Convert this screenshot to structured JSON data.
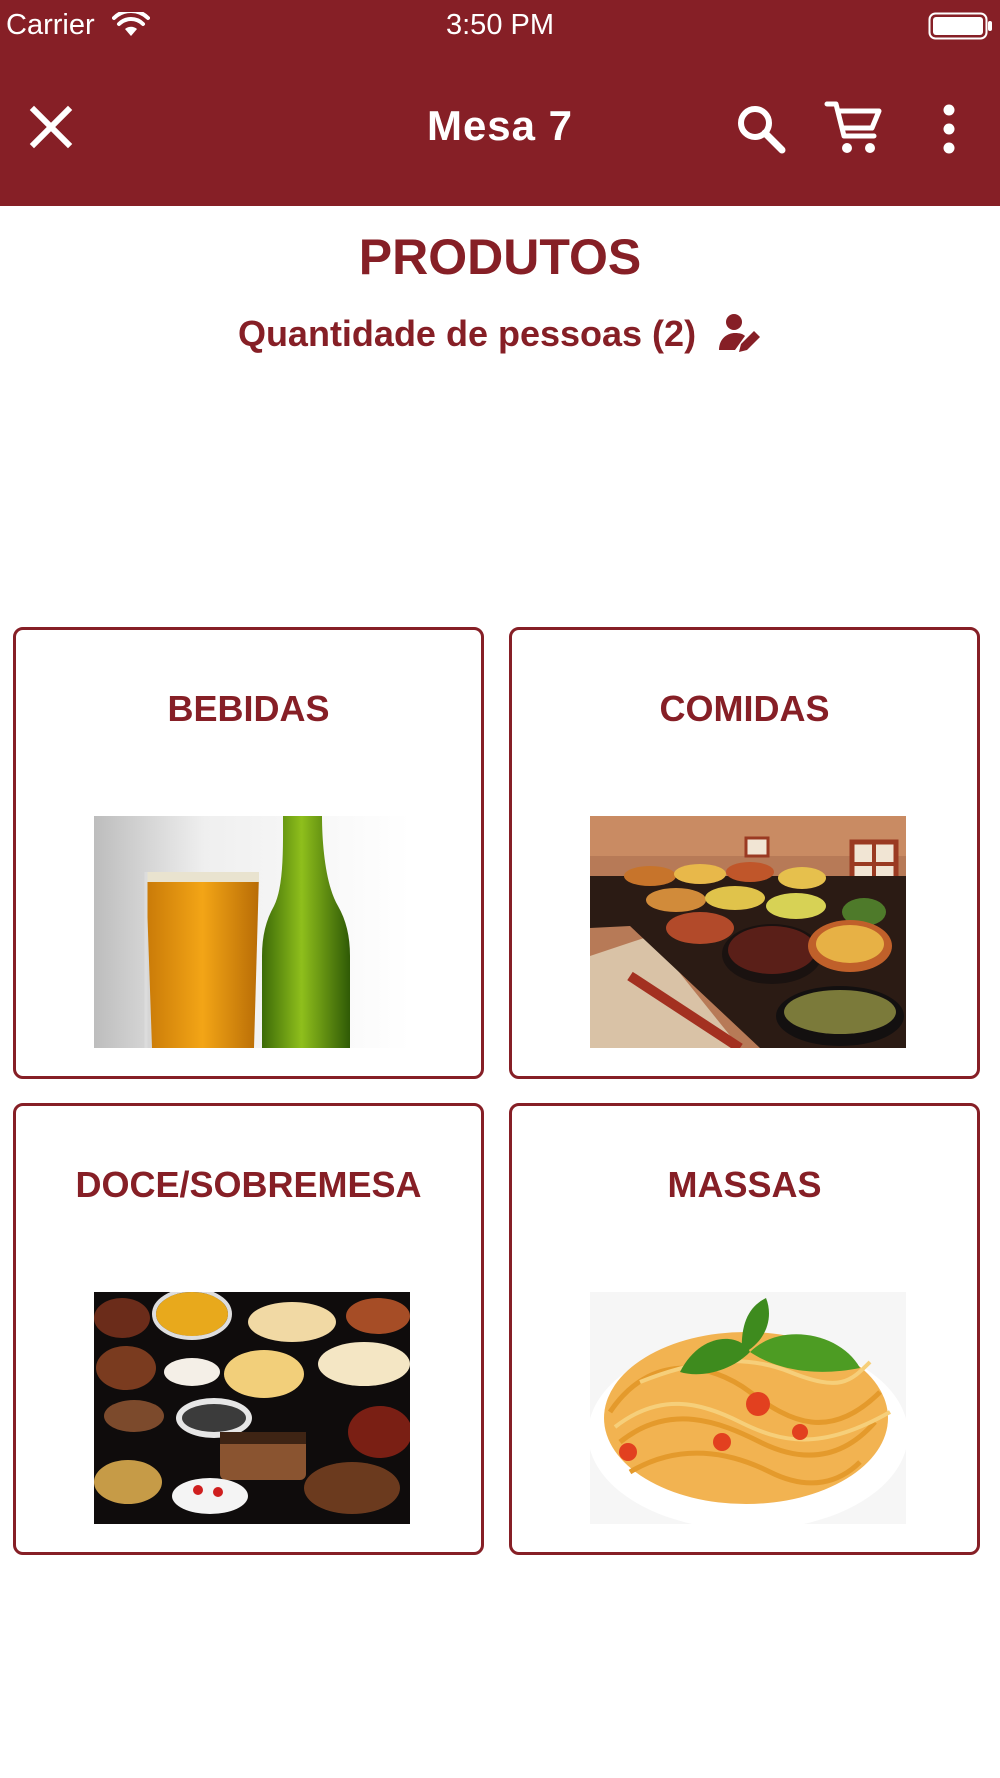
{
  "status_bar": {
    "carrier": "Carrier",
    "time": "3:50 PM",
    "wifi_icon": "wifi-icon",
    "battery_icon": "battery-icon"
  },
  "toolbar": {
    "title": "Mesa  7",
    "icons": [
      "close-icon",
      "search-icon",
      "cart-icon",
      "more-vertical-icon"
    ],
    "background_color": "#861f26"
  },
  "main": {
    "heading": "PRODUTOS",
    "people_label": "Quantidade de pessoas (2)",
    "people_icon": "person-edit-icon",
    "accent_color": "#861f26"
  },
  "categories": [
    {
      "label": "BEBIDAS",
      "image": "beer-glass-and-bottle"
    },
    {
      "label": "COMIDAS",
      "image": "buffet-food-trays"
    },
    {
      "label": "DOCE/SOBREMESA",
      "image": "assorted-cakes"
    },
    {
      "label": "MASSAS",
      "image": "spaghetti-with-tomato-and-basil"
    }
  ]
}
